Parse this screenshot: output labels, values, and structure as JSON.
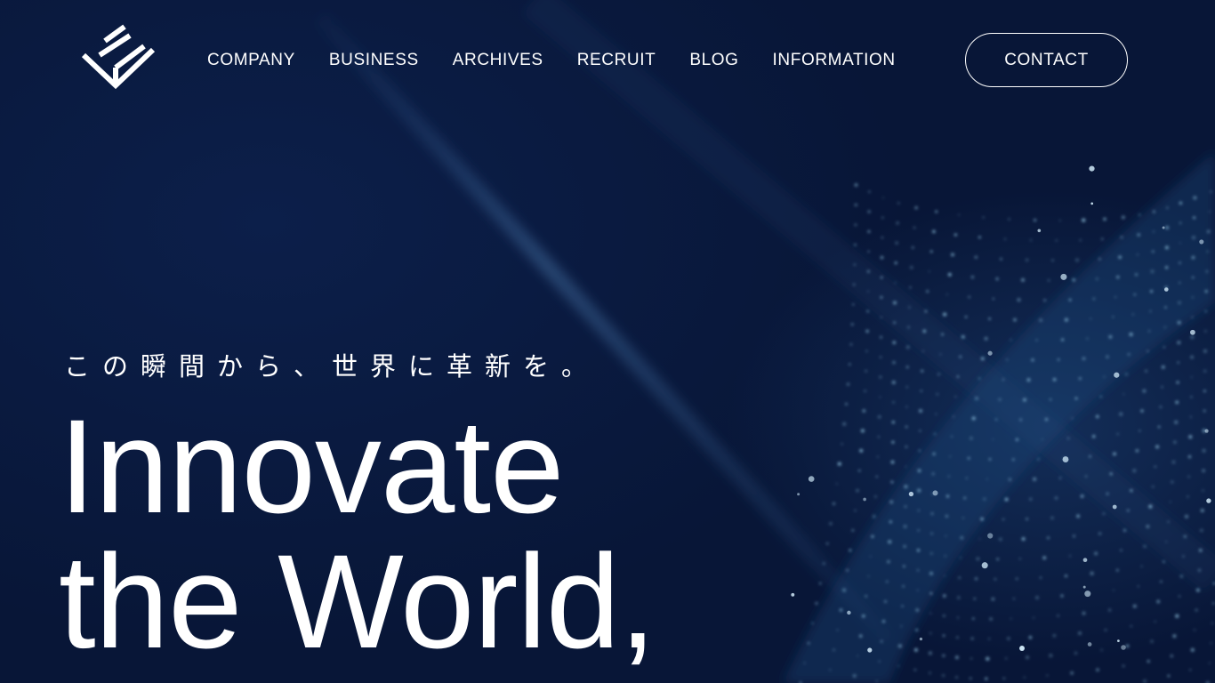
{
  "brand": {
    "logo_icon": "chevron-e-logo-icon"
  },
  "nav": {
    "items": [
      {
        "label": "COMPANY"
      },
      {
        "label": "BUSINESS"
      },
      {
        "label": "ARCHIVES"
      },
      {
        "label": "RECRUIT"
      },
      {
        "label": "BLOG"
      },
      {
        "label": "INFORMATION"
      }
    ],
    "contact_label": "CONTACT"
  },
  "hero": {
    "tagline": "この瞬間から、世界に革新を。",
    "headline_line1": "Innovate",
    "headline_line2": "the World,"
  },
  "colors": {
    "background": "#0a1a3d",
    "text": "#ffffff",
    "particle": "#9fd6f2"
  }
}
